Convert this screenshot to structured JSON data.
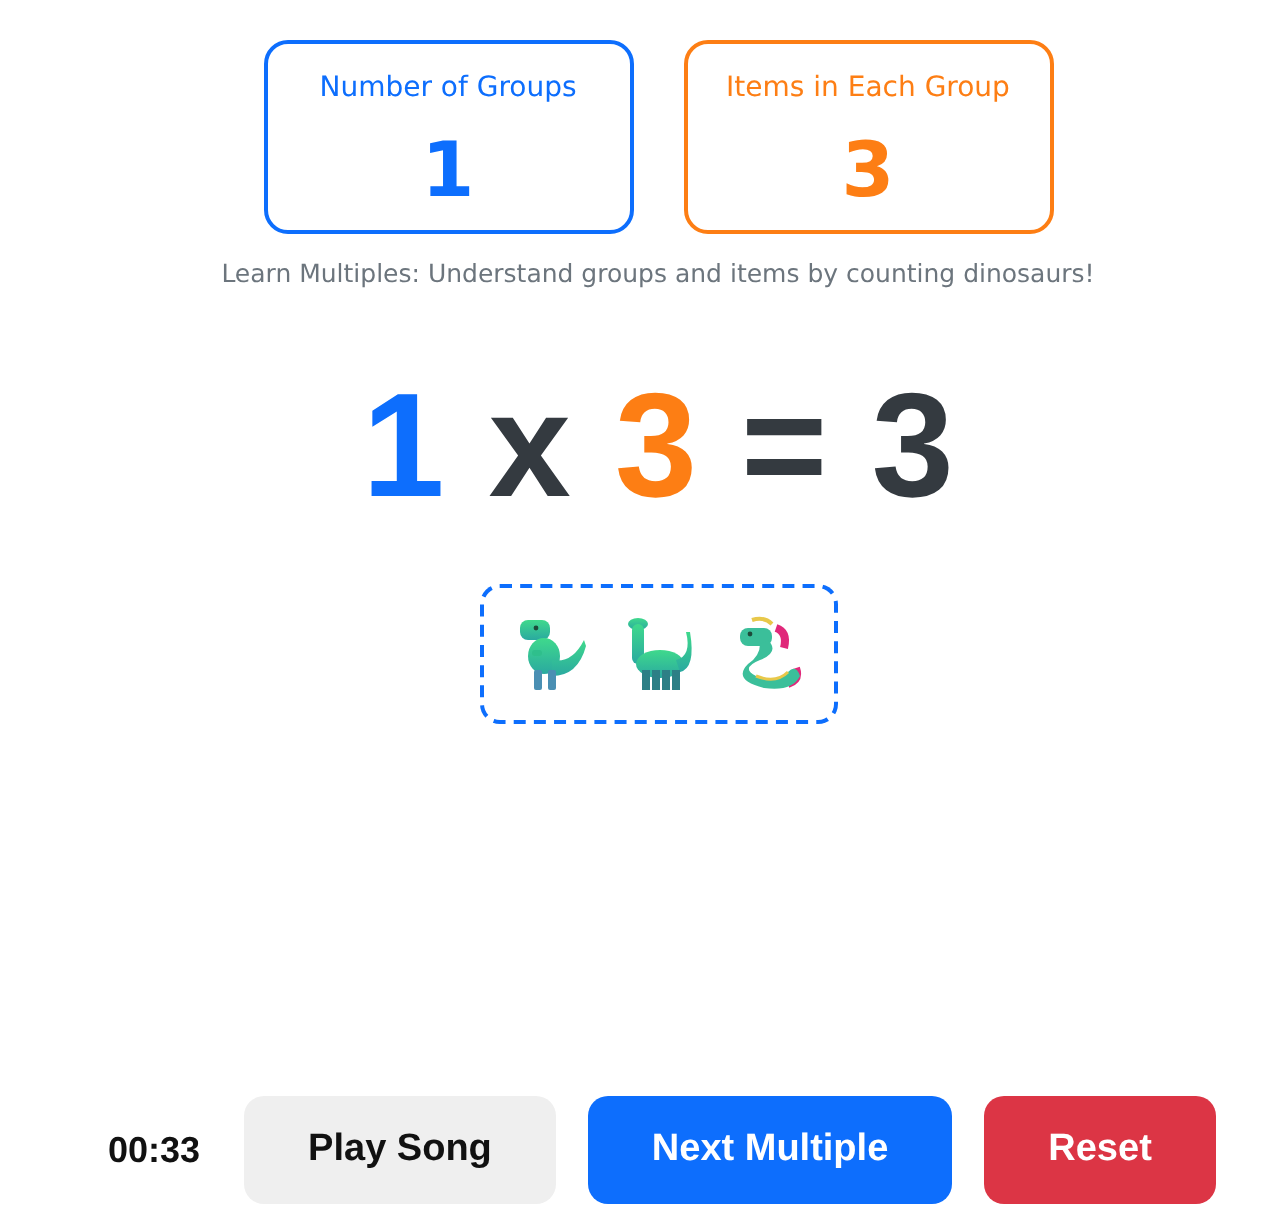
{
  "counters": [
    {
      "kind": "groups",
      "label": "Number of Groups",
      "value": "1"
    },
    {
      "kind": "items",
      "label": "Items in Each Group",
      "value": "3"
    }
  ],
  "subtitle": "Learn Multiples: Understand groups and items by counting dinosaurs!",
  "equation": [
    {
      "kind": "groups",
      "text": "1"
    },
    {
      "kind": "operator",
      "text": "x"
    },
    {
      "kind": "items",
      "text": "3"
    },
    {
      "kind": "operator",
      "text": "="
    },
    {
      "kind": "product",
      "text": "3"
    }
  ],
  "dinosaurs": [
    {
      "kind": "trex"
    },
    {
      "kind": "sauropod"
    },
    {
      "kind": "dragon"
    }
  ],
  "timer": "00:33",
  "buttons": [
    {
      "kind": "secondary",
      "label": "Play Song"
    },
    {
      "kind": "primary",
      "label": "Next Multiple"
    },
    {
      "kind": "danger",
      "label": "Reset"
    }
  ]
}
